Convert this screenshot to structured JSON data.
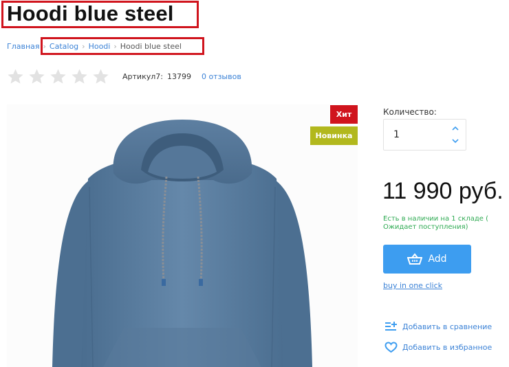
{
  "product": {
    "title": "Hoodi blue steel",
    "article_label": "Артикул7:",
    "article_value": "13799",
    "reviews": "0 отзывов",
    "rating": 0,
    "rating_max": 5
  },
  "breadcrumb": {
    "home": "Главная",
    "catalog": "Catalog",
    "category": "Hoodi",
    "current": "Hoodi blue steel"
  },
  "badges": {
    "hit": "Хит",
    "new": "Новинка"
  },
  "quantity": {
    "label": "Количество:",
    "value": "1"
  },
  "price": "11 990 руб.",
  "stock_text": "Есть в наличии на 1 складе ( Ожидает поступления)",
  "buttons": {
    "add": "Add",
    "buy_one_click": "buy in one click"
  },
  "actions": {
    "compare": "Добавить в сравнение",
    "favorite": "Добавить в избранное"
  },
  "icons": {
    "cart": "basket-icon",
    "compare": "compare-icon",
    "favorite": "heart-icon",
    "star": "star-icon"
  },
  "colors": {
    "accent": "#3d9df0",
    "link": "#3b82d6",
    "hit_badge": "#d0141d",
    "new_badge": "#b2b81d",
    "stock": "#2eaa52",
    "star": "#e2e2e2"
  }
}
